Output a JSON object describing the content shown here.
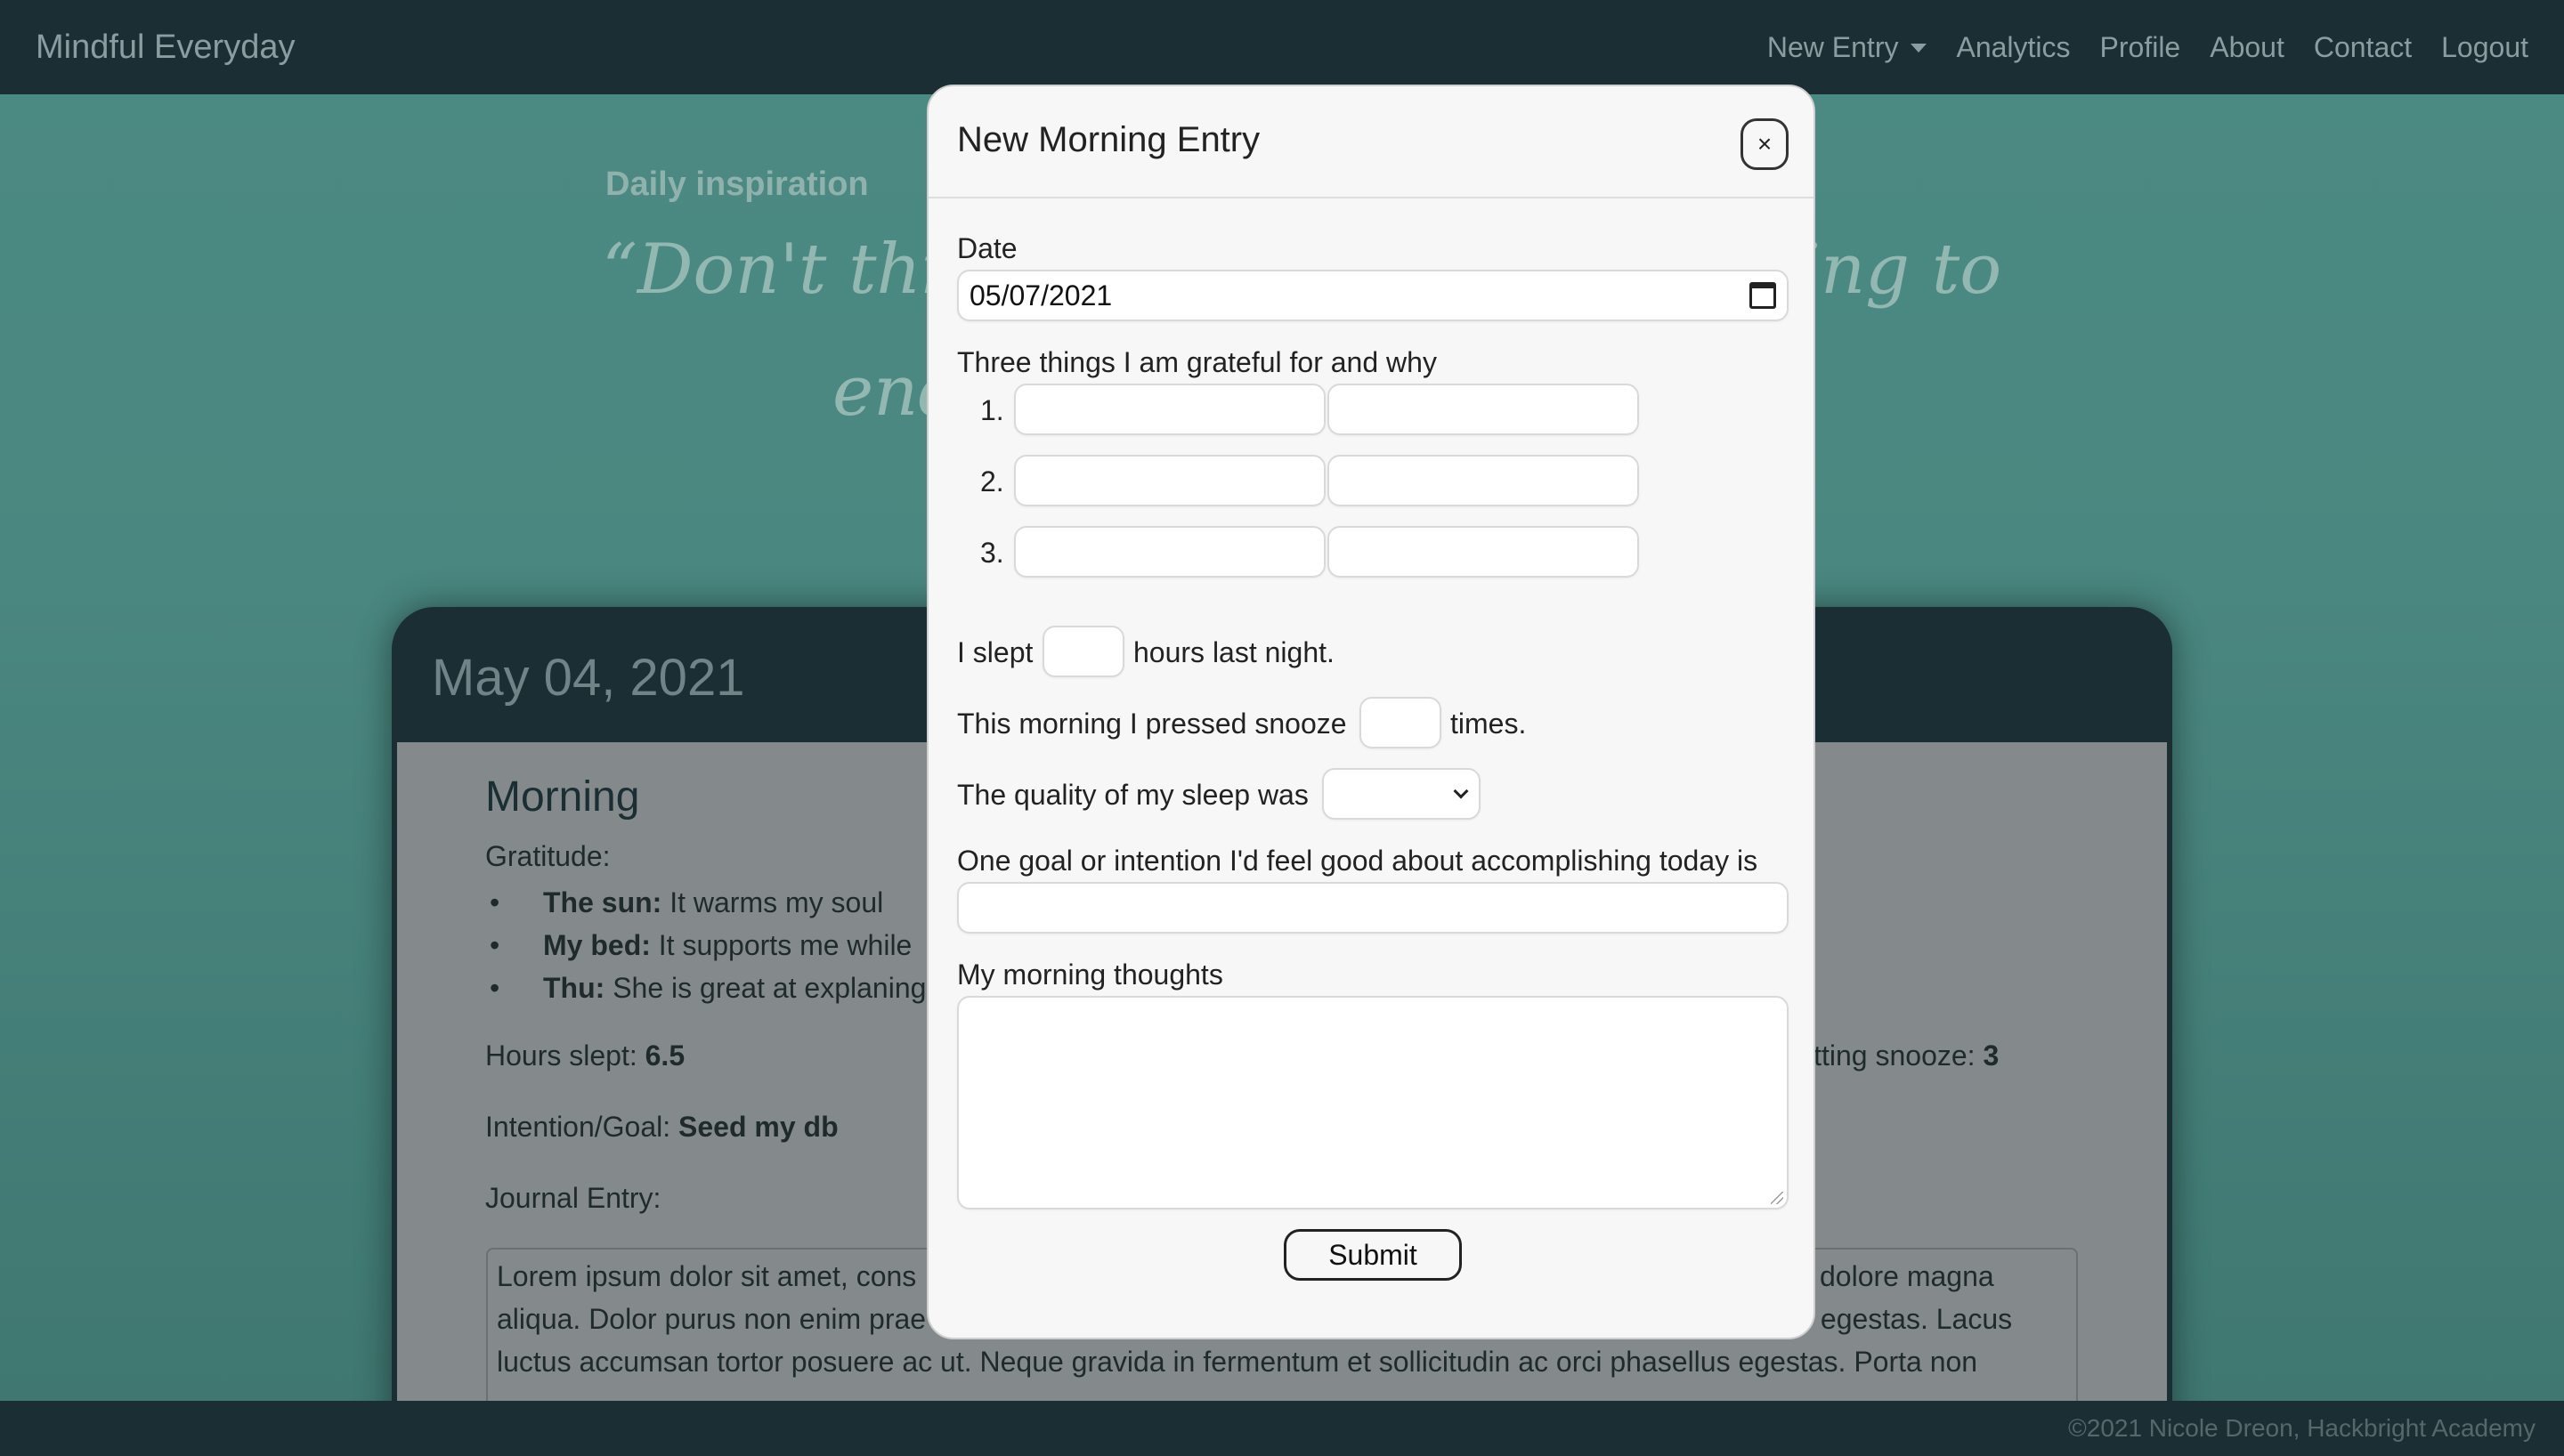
{
  "navbar": {
    "brand": "Mindful Everyday",
    "links": [
      "New Entry",
      "Analytics",
      "Profile",
      "About",
      "Contact",
      "Logout"
    ]
  },
  "inspiration": {
    "heading": "Daily inspiration",
    "quote_line1": "“Don't think",
    "quote_line1_right": "ing to",
    "quote_line2": "end"
  },
  "card": {
    "date": "May 04, 2021",
    "section_title": "Morning",
    "gratitude_label": "Gratitude:",
    "gratitude_items": [
      {
        "title": "The sun:",
        "text": "It warms my soul"
      },
      {
        "title": "My bed:",
        "text": "It supports me while"
      },
      {
        "title": "Thu:",
        "text": "She is great at explaning"
      }
    ],
    "hours_slept_label": "Hours slept:",
    "hours_slept_value": "6.5",
    "snooze_label": "itting snooze:",
    "snooze_value": "3",
    "intention_label": "Intention/Goal:",
    "intention_value": "Seed my db",
    "journal_label": "Journal Entry:",
    "journal_line1_left": "Lorem ipsum dolor sit amet, cons",
    "journal_line1_right": "dolore magna",
    "journal_line2_left": "aliqua. Dolor purus non enim prae",
    "journal_line2_right": "s egestas. Lacus",
    "journal_line3": "luctus accumsan tortor posuere ac ut. Neque gravida in fermentum et sollicitudin ac orci phasellus egestas. Porta non"
  },
  "modal": {
    "title": "New Morning Entry",
    "close_label": "×",
    "date_label": "Date",
    "date_value": "05/07/2021",
    "gratitude_label": "Three things I am grateful for and why",
    "gratitude_numbers": [
      "1.",
      "2.",
      "3."
    ],
    "slept_prefix": "I slept",
    "slept_suffix": "hours last night.",
    "snooze_prefix": "This morning I pressed snooze",
    "snooze_suffix": "times.",
    "quality_label": "The quality of my sleep was",
    "goal_label": "One goal or intention I'd feel good about accomplishing today is",
    "thoughts_label": "My morning thoughts",
    "submit_label": "Submit"
  },
  "footer": {
    "text": "©2021 Nicole Dreon, Hackbright Academy"
  }
}
